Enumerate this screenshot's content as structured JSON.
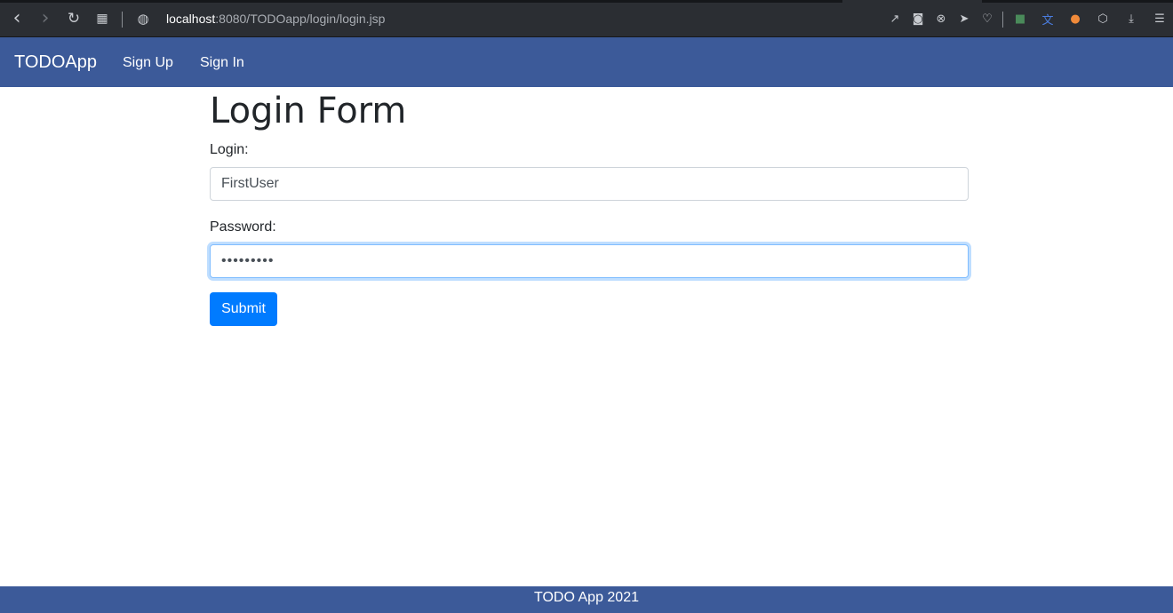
{
  "browser": {
    "url_host": "localhost",
    "url_rest": ":8080/TODOapp/login/login.jsp",
    "icons": {
      "back": "‹",
      "forward": "›",
      "reload": "↻",
      "tabs": "▦",
      "site_info": "◍",
      "share": "↗",
      "snapshot": "◙",
      "block": "⊗",
      "send": "➤",
      "heart": "♡",
      "ext1": "■",
      "ext2": "文",
      "ext3": "●",
      "ext4": "⬡",
      "download": "⤓",
      "menu": "☰"
    }
  },
  "navbar": {
    "brand": "TODOApp",
    "links": [
      "Sign Up",
      "Sign In"
    ],
    "color": "#3c5a99"
  },
  "form": {
    "title": "Login Form",
    "login_label": "Login:",
    "login_value": "FirstUser",
    "password_label": "Password:",
    "password_value": "•••••••••",
    "submit_label": "Submit",
    "accent": "#007bff"
  },
  "footer": {
    "text": "TODO App 2021"
  }
}
